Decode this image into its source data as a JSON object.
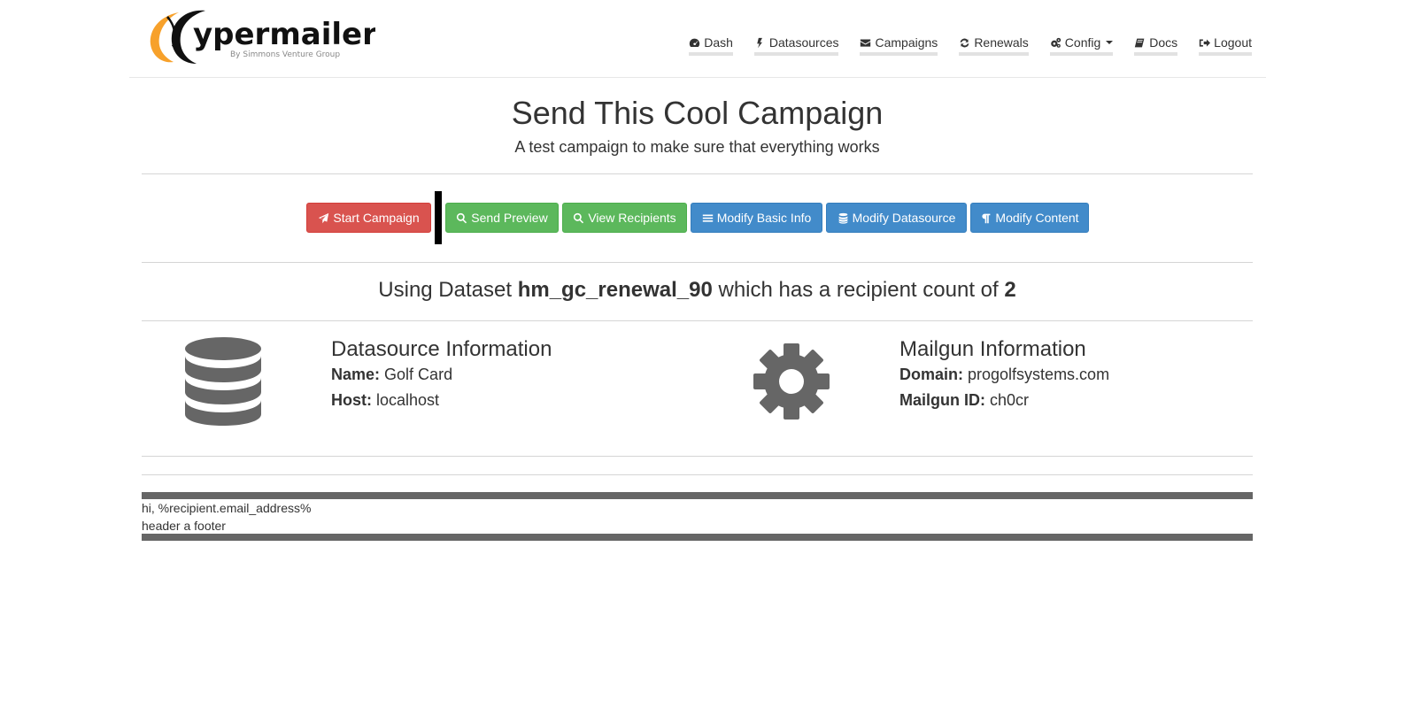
{
  "brand": {
    "logo_letter": "ypermailer",
    "logo_tagline": "By Simmons Venture Group"
  },
  "nav": {
    "items": [
      {
        "label": "Dash",
        "icon": "dashboard-icon"
      },
      {
        "label": "Datasources",
        "icon": "bolt-icon"
      },
      {
        "label": "Campaigns",
        "icon": "envelope-icon"
      },
      {
        "label": "Renewals",
        "icon": "refresh-icon"
      },
      {
        "label": "Config",
        "icon": "cogs-icon",
        "dropdown": true
      },
      {
        "label": "Docs",
        "icon": "book-icon"
      },
      {
        "label": "Logout",
        "icon": "sign-out-icon"
      }
    ]
  },
  "header": {
    "title": "Send This Cool Campaign",
    "subtitle": "A test campaign to make sure that everything works"
  },
  "actions": {
    "start": "Start Campaign",
    "send_preview": "Send Preview",
    "view_recipients": "View Recipients",
    "modify_basic": "Modify Basic Info",
    "modify_datasource": "Modify Datasource",
    "modify_content": "Modify Content"
  },
  "dataset": {
    "prefix": "Using Dataset ",
    "name": "hm_gc_renewal_90",
    "middle": " which has a recipient count of ",
    "count": "2"
  },
  "datasource_info": {
    "title": "Datasource Information",
    "name_label": "Name:",
    "name_value": "Golf Card",
    "host_label": "Host:",
    "host_value": "localhost"
  },
  "mailgun_info": {
    "title": "Mailgun Information",
    "domain_label": "Domain:",
    "domain_value": "progolfsystems.com",
    "id_label": "Mailgun ID:",
    "id_value": "ch0cr"
  },
  "content_preview": {
    "line1": "hi, %recipient.email_address%",
    "line2": "header a footer"
  },
  "colors": {
    "danger": "#d9534f",
    "success": "#5cb85c",
    "primary": "#428bca",
    "logo_orange": "#f7a12b",
    "icon_gray": "#666666"
  }
}
